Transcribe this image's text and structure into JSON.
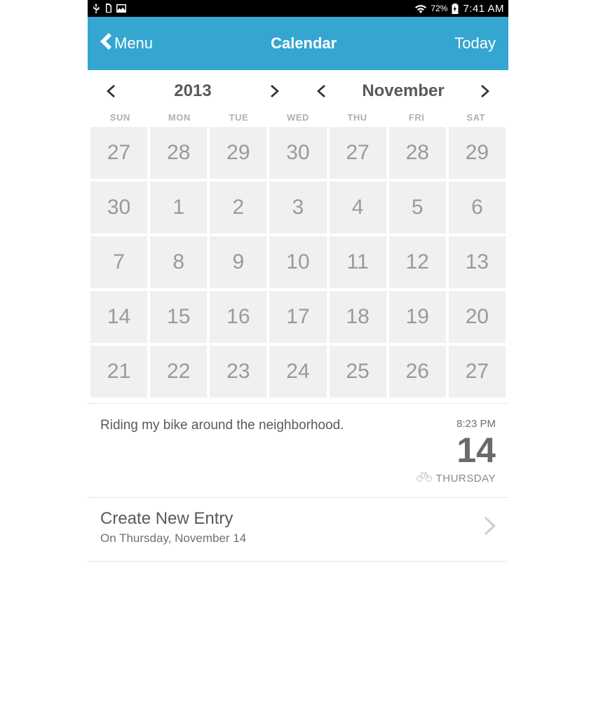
{
  "statusbar": {
    "battery_pct": "72%",
    "time": "7:41 AM"
  },
  "header": {
    "menu_label": "Menu",
    "title": "Calendar",
    "today_label": "Today"
  },
  "picker": {
    "year": "2013",
    "month": "November"
  },
  "weekdays": [
    "SUN",
    "MON",
    "TUE",
    "WED",
    "THU",
    "FRI",
    "SAT"
  ],
  "grid_days": [
    "27",
    "28",
    "29",
    "30",
    "27",
    "28",
    "29",
    "30",
    "1",
    "2",
    "3",
    "4",
    "5",
    "6",
    "7",
    "8",
    "9",
    "10",
    "11",
    "12",
    "13",
    "14",
    "15",
    "16",
    "17",
    "18",
    "19",
    "20",
    "21",
    "22",
    "23",
    "24",
    "25",
    "26",
    "27"
  ],
  "entry": {
    "text": "Riding my bike around the neighborhood.",
    "time": "8:23 PM",
    "day_number": "14",
    "day_name": "THURSDAY"
  },
  "create": {
    "title": "Create New Entry",
    "subtitle": "On Thursday, November 14"
  }
}
